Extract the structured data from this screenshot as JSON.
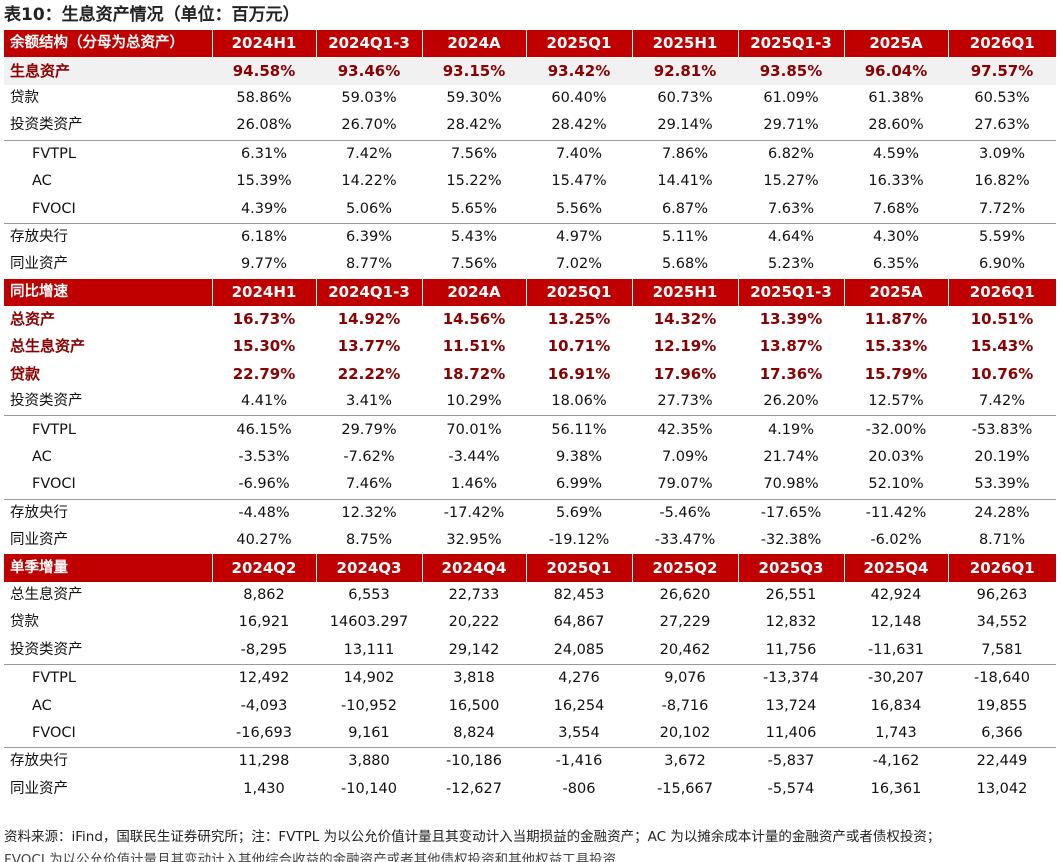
{
  "title": "表10：生息资产情况（单位：百万元）",
  "sections": [
    {
      "header": [
        "余额结构（分母为总资产）",
        "2024H1",
        "2024Q1-3",
        "2024A",
        "2025Q1",
        "2025H1",
        "2025Q1-3",
        "2025A",
        "2026Q1"
      ],
      "rows": [
        {
          "label": "生息资产",
          "cells": [
            "94.58%",
            "93.46%",
            "93.15%",
            "93.42%",
            "92.81%",
            "93.85%",
            "96.04%",
            "97.57%"
          ],
          "style": "hl shade"
        },
        {
          "label": "贷款",
          "cells": [
            "58.86%",
            "59.03%",
            "59.30%",
            "60.40%",
            "60.73%",
            "61.09%",
            "61.38%",
            "60.53%"
          ],
          "style": ""
        },
        {
          "label": "投资类资产",
          "cells": [
            "26.08%",
            "26.70%",
            "28.42%",
            "28.42%",
            "29.14%",
            "29.71%",
            "28.60%",
            "27.63%"
          ],
          "style": ""
        },
        {
          "label": "FVTPL",
          "cells": [
            "6.31%",
            "7.42%",
            "7.56%",
            "7.40%",
            "7.86%",
            "6.82%",
            "4.59%",
            "3.09%"
          ],
          "style": "sub sep"
        },
        {
          "label": "AC",
          "cells": [
            "15.39%",
            "14.22%",
            "15.22%",
            "15.47%",
            "14.41%",
            "15.27%",
            "16.33%",
            "16.82%"
          ],
          "style": "sub"
        },
        {
          "label": "FVOCI",
          "cells": [
            "4.39%",
            "5.06%",
            "5.65%",
            "5.56%",
            "6.87%",
            "7.63%",
            "7.68%",
            "7.72%"
          ],
          "style": "sub"
        },
        {
          "label": "存放央行",
          "cells": [
            "6.18%",
            "6.39%",
            "5.43%",
            "4.97%",
            "5.11%",
            "4.64%",
            "4.30%",
            "5.59%"
          ],
          "style": "sep"
        },
        {
          "label": "同业资产",
          "cells": [
            "9.77%",
            "8.77%",
            "7.56%",
            "7.02%",
            "5.68%",
            "5.23%",
            "6.35%",
            "6.90%"
          ],
          "style": ""
        }
      ]
    },
    {
      "header": [
        "同比增速",
        "2024H1",
        "2024Q1-3",
        "2024A",
        "2025Q1",
        "2025H1",
        "2025Q1-3",
        "2025A",
        "2026Q1"
      ],
      "rows": [
        {
          "label": "总资产",
          "cells": [
            "16.73%",
            "14.92%",
            "14.56%",
            "13.25%",
            "14.32%",
            "13.39%",
            "11.87%",
            "10.51%"
          ],
          "style": "hl"
        },
        {
          "label": "总生息资产",
          "cells": [
            "15.30%",
            "13.77%",
            "11.51%",
            "10.71%",
            "12.19%",
            "13.87%",
            "15.33%",
            "15.43%"
          ],
          "style": "hl"
        },
        {
          "label": "贷款",
          "cells": [
            "22.79%",
            "22.22%",
            "18.72%",
            "16.91%",
            "17.96%",
            "17.36%",
            "15.79%",
            "10.76%"
          ],
          "style": "hl"
        },
        {
          "label": "投资类资产",
          "cells": [
            "4.41%",
            "3.41%",
            "10.29%",
            "18.06%",
            "27.73%",
            "26.20%",
            "12.57%",
            "7.42%"
          ],
          "style": ""
        },
        {
          "label": "FVTPL",
          "cells": [
            "46.15%",
            "29.79%",
            "70.01%",
            "56.11%",
            "42.35%",
            "4.19%",
            "-32.00%",
            "-53.83%"
          ],
          "style": "sub sep"
        },
        {
          "label": "AC",
          "cells": [
            "-3.53%",
            "-7.62%",
            "-3.44%",
            "9.38%",
            "7.09%",
            "21.74%",
            "20.03%",
            "20.19%"
          ],
          "style": "sub"
        },
        {
          "label": "FVOCI",
          "cells": [
            "-6.96%",
            "7.46%",
            "1.46%",
            "6.99%",
            "79.07%",
            "70.98%",
            "52.10%",
            "53.39%"
          ],
          "style": "sub"
        },
        {
          "label": "存放央行",
          "cells": [
            "-4.48%",
            "12.32%",
            "-17.42%",
            "5.69%",
            "-5.46%",
            "-17.65%",
            "-11.42%",
            "24.28%"
          ],
          "style": "sep"
        },
        {
          "label": "同业资产",
          "cells": [
            "40.27%",
            "8.75%",
            "32.95%",
            "-19.12%",
            "-33.47%",
            "-32.38%",
            "-6.02%",
            "8.71%"
          ],
          "style": ""
        }
      ]
    },
    {
      "header": [
        "单季增量",
        "2024Q2",
        "2024Q3",
        "2024Q4",
        "2025Q1",
        "2025Q2",
        "2025Q3",
        "2025Q4",
        "2026Q1"
      ],
      "rows": [
        {
          "label": "总生息资产",
          "cells": [
            "8,862",
            "6,553",
            "22,733",
            "82,453",
            "26,620",
            "26,551",
            "42,924",
            "96,263"
          ],
          "style": ""
        },
        {
          "label": "贷款",
          "cells": [
            "16,921",
            "14603.297",
            "20,222",
            "64,867",
            "27,229",
            "12,832",
            "12,148",
            "34,552"
          ],
          "style": ""
        },
        {
          "label": "投资类资产",
          "cells": [
            "-8,295",
            "13,111",
            "29,142",
            "24,085",
            "20,462",
            "11,756",
            "-11,631",
            "7,581"
          ],
          "style": ""
        },
        {
          "label": "FVTPL",
          "cells": [
            "12,492",
            "14,902",
            "3,818",
            "4,276",
            "9,076",
            "-13,374",
            "-30,207",
            "-18,640"
          ],
          "style": "sub sep"
        },
        {
          "label": "AC",
          "cells": [
            "-4,093",
            "-10,952",
            "16,500",
            "16,254",
            "-8,716",
            "13,724",
            "16,834",
            "19,855"
          ],
          "style": "sub"
        },
        {
          "label": "FVOCI",
          "cells": [
            "-16,693",
            "9,161",
            "8,824",
            "3,554",
            "20,102",
            "11,406",
            "1,743",
            "6,366"
          ],
          "style": "sub"
        },
        {
          "label": "存放央行",
          "cells": [
            "11,298",
            "3,880",
            "-10,186",
            "-1,416",
            "3,672",
            "-5,837",
            "-4,162",
            "22,449"
          ],
          "style": "sep"
        },
        {
          "label": "同业资产",
          "cells": [
            "1,430",
            "-10,140",
            "-12,627",
            "-806",
            "-15,667",
            "-5,574",
            "16,361",
            "13,042"
          ],
          "style": ""
        }
      ]
    }
  ],
  "note": "资料来源：iFind，国联民生证券研究所；注：FVTPL 为以公允价值计量且其变动计入当期损益的金融资产；AC 为以摊余成本计量的金融资产或者债权投资；",
  "note_line2": "FVOCI 为以公允价值计量且其变动计入其他综合收益的金融资产或者其他债权投资和其他权益工具投资"
}
